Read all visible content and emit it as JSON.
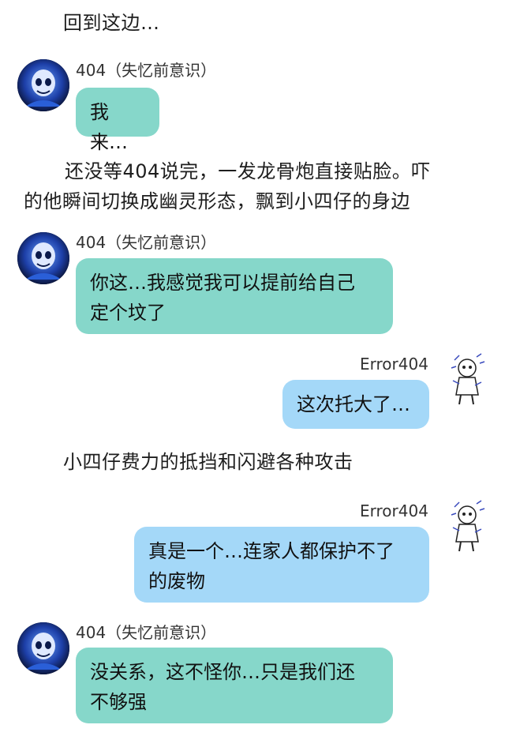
{
  "chat": {
    "narration_1": "回到这边…",
    "narration_2_line1": "还没等404说完，一发龙骨炮直接贴脸。吓",
    "narration_2_line2": "的他瞬间切换成幽灵形态，飘到小四仔的身边",
    "narration_3": "小四仔费力的抵挡和闪避各种攻击",
    "left_speaker": "404（失忆前意识）",
    "right_speaker": "Error404",
    "msg_1": "我来…",
    "msg_2_line1": "你这…我感觉我可以提前给自己",
    "msg_2_line2": "定个坟了",
    "msg_3": "这次托大了…",
    "msg_4_line1": "真是一个…连家人都保护不了",
    "msg_4_line2": "的废物",
    "msg_5_line1": "没关系，这不怪你…只是我们还",
    "msg_5_line2": "不够强"
  },
  "icons": {
    "left_avatar": "blue-skeleton-avatar-icon",
    "right_avatar": "glitch-skeleton-sketch-avatar-icon"
  },
  "colors": {
    "left_bubble": "#86d7ca",
    "right_bubble": "#a4d8f8",
    "background": "#ffffff"
  }
}
